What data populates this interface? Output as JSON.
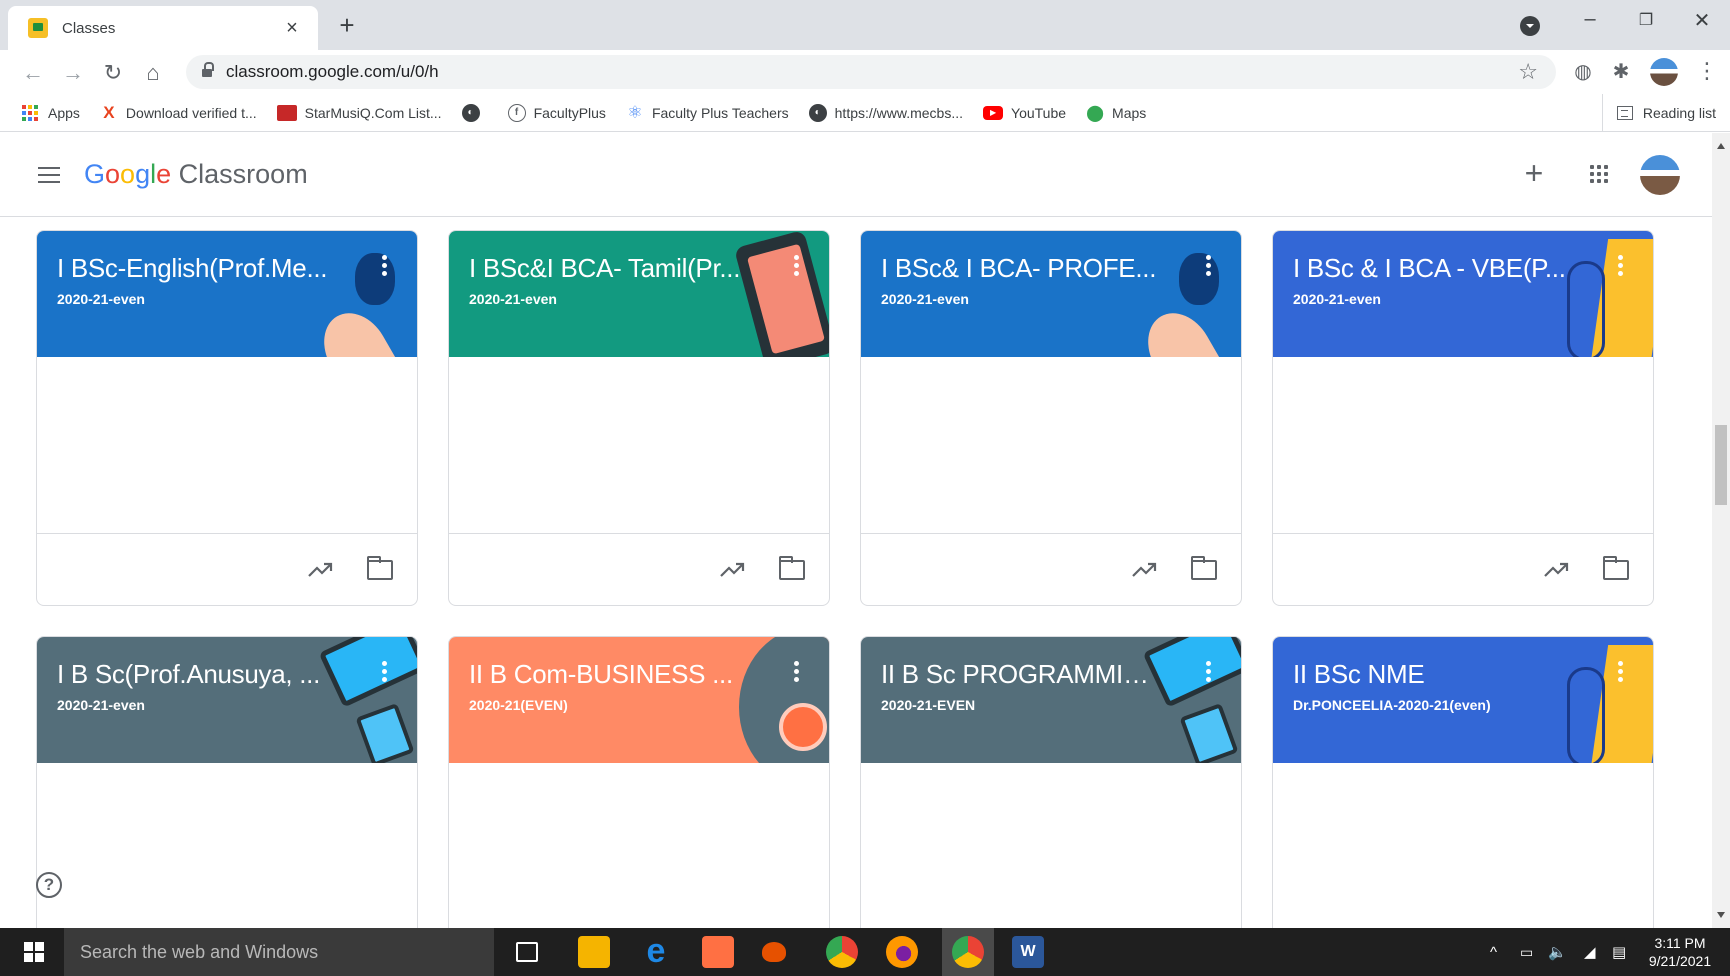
{
  "browser": {
    "tab_title": "Classes",
    "tab_close": "×",
    "new_tab": "+",
    "window_controls": [
      "–",
      "❐",
      "✕"
    ],
    "url": "classroom.google.com/u/0/h",
    "bookmarks": [
      {
        "label": "Apps",
        "icon": "apps-grid-icon"
      },
      {
        "label": "Download verified t...",
        "icon": "x-logo-icon",
        "color": "#e8431f"
      },
      {
        "label": "StarMusiQ.Com List...",
        "icon": "starmusiq-icon",
        "color": "#c62828"
      },
      {
        "label": "",
        "icon": "globe-icon",
        "color": "#3c4043"
      },
      {
        "label": "FacultyPlus",
        "icon": "facultyplus-icon",
        "color": "#5f6368"
      },
      {
        "label": "Faculty Plus Teachers",
        "icon": "atom-icon",
        "color": "#4285f4"
      },
      {
        "label": "https://www.mecbs...",
        "icon": "globe-icon",
        "color": "#3c4043"
      },
      {
        "label": "YouTube",
        "icon": "youtube-icon",
        "color": "#ff0000"
      },
      {
        "label": "Maps",
        "icon": "maps-pin-icon",
        "color": "#34a853"
      }
    ],
    "reading_list": "Reading list"
  },
  "classroom": {
    "logo_google": [
      "G",
      "o",
      "o",
      "g",
      "l",
      "e"
    ],
    "logo_product": "Classroom",
    "create_label": "+",
    "help_label": "?",
    "cards": [
      {
        "title": "I BSc-English(Prof.Me...",
        "section": "2020-21-even",
        "color": "#1a73c8",
        "theme": "writing"
      },
      {
        "title": "I BSc&I BCA- Tamil(Pr...",
        "section": "2020-21-even",
        "color": "#129a80",
        "theme": "phone"
      },
      {
        "title": "I BSc& I BCA- PROFE...",
        "section": "2020-21-even",
        "color": "#1a73c8",
        "theme": "writing"
      },
      {
        "title": "I BSc & I BCA - VBE(P...",
        "section": "2020-21-even",
        "color": "#3367d6",
        "theme": "music"
      },
      {
        "title": "I B Sc(Prof.Anusuya, ...",
        "section": "2020-21-even",
        "color": "#546e7a",
        "theme": "devices"
      },
      {
        "title": "II B Com-BUSINESS ...",
        "section": "2020-21(EVEN)",
        "color": "#ff8a65",
        "theme": "sports"
      },
      {
        "title": "II B Sc PROGRAMMIN...",
        "section": "2020-21-EVEN",
        "color": "#546e7a",
        "theme": "devices"
      },
      {
        "title": "II BSc NME",
        "section": "Dr.PONCEELIA-2020-21(even)",
        "color": "#3367d6",
        "theme": "music"
      }
    ]
  },
  "taskbar": {
    "search_placeholder": "Search the web and Windows",
    "time": "3:11 PM",
    "date": "9/21/2021"
  }
}
